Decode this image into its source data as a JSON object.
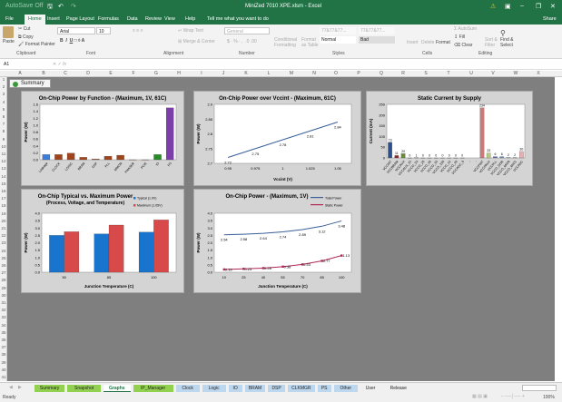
{
  "window": {
    "autosave": "AutoSave",
    "autosave_state": "Off",
    "title": "MiniZed 7010 XPE.xlsm - Excel",
    "share": "Share"
  },
  "ribbon_tabs": [
    "File",
    "Home",
    "Insert",
    "Page Layout",
    "Formulas",
    "Data",
    "Review",
    "View",
    "Help"
  ],
  "tell_me": "Tell me what you want to do",
  "ribbon": {
    "paste": "Paste",
    "cut": "Cut",
    "copy": "Copy",
    "format_painter": "Format Painter",
    "clipboard": "Clipboard",
    "font_name": "Arial",
    "font_size": "10",
    "font": "Font",
    "wrap_text": "Wrap Text",
    "merge_center": "Merge & Center",
    "alignment": "Alignment",
    "number_format": "General",
    "number": "Number",
    "conditional_formatting": "Conditional Formatting",
    "format_as_table": "Format as Table",
    "style_normal": "Normal",
    "style_bad": "Bad",
    "style_sample": "77&77&77...",
    "styles": "Styles",
    "insert": "Insert",
    "delete": "Delete",
    "format": "Format",
    "cells": "Cells",
    "autosum": "AutoSum",
    "fill": "Fill",
    "clear": "Clear",
    "sort_filter": "Sort & Filter",
    "find_select": "Find & Select",
    "editing": "Editing"
  },
  "formula_bar": {
    "name_box": "A1",
    "value": ""
  },
  "columns": [
    "A",
    "B",
    "C",
    "D",
    "E",
    "F",
    "G",
    "H",
    "I",
    "J",
    "K",
    "L",
    "M",
    "N",
    "O",
    "P",
    "Q",
    "R",
    "S",
    "T",
    "U",
    "V",
    "W",
    "X"
  ],
  "rows": [
    "1",
    "2",
    "3",
    "4",
    "5",
    "6",
    "7",
    "8",
    "9",
    "10",
    "11",
    "12",
    "13",
    "14",
    "15",
    "16",
    "17",
    "18",
    "19",
    "20",
    "21",
    "22",
    "23",
    "24",
    "25",
    "26",
    "27",
    "28",
    "29",
    "30",
    "31",
    "32",
    "33",
    "34",
    "35",
    "36",
    "37",
    "38",
    "39",
    "40",
    "41"
  ],
  "summary_button": "Summary",
  "chart_data": [
    {
      "id": "function",
      "type": "bar",
      "title": "On-Chip Power by Function - (Maximum, 1V, 61C)",
      "ylabel": "Power (W)",
      "xlabel": "",
      "ylim": [
        0,
        1.6
      ],
      "yticks": [
        0,
        0.2,
        0.4,
        0.6,
        0.8,
        1.0,
        1.2,
        1.4,
        1.6
      ],
      "categories": [
        "Leakage",
        "CLOCK",
        "LOGIC",
        "BRAM",
        "DSP",
        "PLL",
        "MMCM",
        "PHASER",
        "PCIE",
        "IO",
        "PS"
      ],
      "values": [
        0.15,
        0.15,
        0.19,
        0.07,
        0.02,
        0.1,
        0.13,
        0,
        0,
        0.15,
        1.5
      ],
      "colors": [
        "#3b7dd8",
        "#a0441c",
        "#a0441c",
        "#a0441c",
        "#a0441c",
        "#a0441c",
        "#a0441c",
        "#a0441c",
        "#a0441c",
        "#2a8a2a",
        "#7b3fa8"
      ],
      "grid": false
    },
    {
      "id": "vccint",
      "type": "line",
      "title": "On-Chip Power over Vccint - (Maximum, 61C)",
      "ylabel": "Power (W)",
      "xlabel": "Vccint (V)",
      "ylim": [
        2.7,
        2.9
      ],
      "yticks": [
        2.7,
        2.75,
        2.8,
        2.85,
        2.9
      ],
      "categories": [
        "0.95",
        "0.975",
        "1",
        "1.025",
        "1.05"
      ],
      "series": [
        {
          "values": [
            2.72,
            2.75,
            2.78,
            2.81,
            2.84
          ],
          "color": "#3a5f9a"
        }
      ],
      "data_labels": true,
      "grid": false
    },
    {
      "id": "static",
      "type": "bar",
      "title": "Static Current by Supply",
      "ylabel": "Current (mA)",
      "xlabel": "",
      "ylim": [
        0,
        250
      ],
      "yticks": [
        0,
        50,
        100,
        150,
        200,
        250
      ],
      "categories": [
        "VCCINT",
        "VCCBRAM",
        "VCCAUX",
        "VCCAUX_IO",
        "VCCO_33",
        "VCCO_25",
        "VCCO_18",
        "VCCO_15",
        "VCCO_135",
        "VCCO_12",
        "VCCO_10",
        "VCCADC_0",
        "-",
        "-",
        "VCCPINT",
        "VCCPAUX",
        "VCCPLL",
        "VCCO_DDR",
        "VCCO_MIO0",
        "VCCO_MIO1",
        "VCCADC"
      ],
      "values": [
        73,
        11,
        20,
        0,
        1,
        0,
        0,
        0,
        0,
        0,
        0,
        0,
        null,
        null,
        234,
        23,
        6,
        6,
        2,
        2,
        30
      ],
      "colors": [
        "#2f4f8a",
        "#8a2a2a",
        "#6a8a3a",
        "#555",
        "#555",
        "#555",
        "#555",
        "#555",
        "#555",
        "#555",
        "#555",
        "#555",
        "#555",
        "#555",
        "#c97a7a",
        "#b8cc88",
        "#6a6aa8",
        "#6a8ab8",
        "#888",
        "#888",
        "#e8b0b0"
      ],
      "data_labels": true,
      "grid": false
    },
    {
      "id": "typmax",
      "type": "bar",
      "title": "On-Chip Typical vs. Maximum Power",
      "subtitle": "(Process, Voltage, and Temperature)",
      "ylabel": "Power (W)",
      "xlabel": "Junction Temperature (C)",
      "ylim": [
        0,
        4
      ],
      "yticks": [
        0,
        0.5,
        1.0,
        1.5,
        2.0,
        2.5,
        3.0,
        3.5,
        4.0
      ],
      "categories": [
        "50",
        "85",
        "100"
      ],
      "series": [
        {
          "name": "Typical (1.0V)",
          "values": [
            2.5,
            2.6,
            2.72
          ],
          "color": "#1874cd"
        },
        {
          "name": "Maximum (1.05V)",
          "values": [
            2.75,
            3.2,
            3.55
          ],
          "color": "#d84a4a"
        }
      ],
      "legend": "top-right",
      "grid": false
    },
    {
      "id": "temp",
      "type": "line",
      "title": "On-Chip Power - (Maximum, 1V)",
      "ylabel": "Power (W)",
      "xlabel": "Junction Temperature (C)",
      "ylim": [
        0,
        4
      ],
      "yticks": [
        0,
        0.5,
        1.0,
        1.5,
        2.0,
        2.5,
        3.0,
        3.5,
        4.0
      ],
      "categories": [
        "10",
        "25",
        "40",
        "55",
        "70",
        "85",
        "100"
      ],
      "series": [
        {
          "name": "Total Power",
          "values": [
            2.54,
            2.58,
            2.64,
            2.74,
            2.89,
            3.12,
            3.48
          ],
          "color": "#3a5f9a"
        },
        {
          "name": "Static Power",
          "values": [
            0.19,
            0.23,
            0.28,
            0.38,
            0.53,
            0.77,
            1.13
          ],
          "color": "#b0285a",
          "markers": true
        }
      ],
      "data_labels": true,
      "legend": "top-right",
      "grid": false
    }
  ],
  "sheet_tabs": [
    {
      "label": "Summary",
      "color": "#92d050"
    },
    {
      "label": "Snapshot",
      "color": "#92d050"
    },
    {
      "label": "Graphs",
      "color": "#ffffff",
      "active": true
    },
    {
      "label": "IP_Manager",
      "color": "#92d050"
    },
    {
      "label": "Clock",
      "color": "#bdd7ee"
    },
    {
      "label": "Logic",
      "color": "#bdd7ee"
    },
    {
      "label": "IO",
      "color": "#bdd7ee"
    },
    {
      "label": "BRAM",
      "color": "#bdd7ee"
    },
    {
      "label": "DSP",
      "color": "#bdd7ee"
    },
    {
      "label": "CLKMGR",
      "color": "#bdd7ee"
    },
    {
      "label": "PS",
      "color": "#bdd7ee"
    },
    {
      "label": "Other",
      "color": "#bdd7ee"
    },
    {
      "label": "User",
      "color": "#f0f0f0"
    },
    {
      "label": "Release",
      "color": "#f0f0f0"
    }
  ],
  "status": {
    "ready": "Ready",
    "zoom": "100%"
  }
}
